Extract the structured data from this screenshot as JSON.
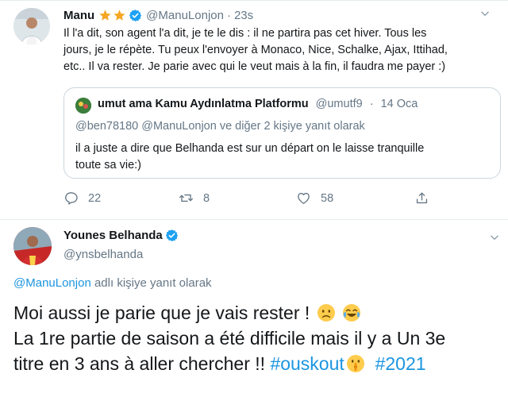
{
  "tweet1": {
    "name": "Manu",
    "handle": "@ManuLonjon",
    "separator": "·",
    "time": "23s",
    "text_lines": [
      "Il l'a dit, son agent l'a dit, je te le dis : il ne partira pas cet hiver. Tous les",
      "jours, je le répète. Tu peux l'envoyer à Monaco, Nice, Schalke, Ajax, Ittihad,",
      "etc.. Il va rester. Je parie avec qui le veut mais à la fin, il faudra me payer :)"
    ],
    "quoted": {
      "name": "umut ama Kamu Aydınlatma Platformu",
      "handle": "@umutf9",
      "separator": "·",
      "date": "14 Oca",
      "reply_line": "@ben78180 @ManuLonjon ve diğer 2 kişiye yanıt olarak",
      "text_lines": [
        "il a juste a dire que Belhanda est sur un départ on le laisse tranquille",
        "toute sa vie:)"
      ]
    },
    "actions": {
      "reply_count": "22",
      "retweet_count": "8",
      "like_count": "58"
    }
  },
  "tweet2": {
    "name": "Younes Belhanda",
    "handle": "@ynsbelhanda",
    "reply_mention": "@ManuLonjon",
    "reply_suffix": "adlı kişiye yanıt olarak",
    "line1": "Moi aussi je parie que je vais rester !",
    "line2": "La 1re partie de saison a été difficile mais il y a Un 3e",
    "line3_text": "titre en 3 ans à aller chercher !! ",
    "hashtag1": "#ouskout",
    "hashtag2": "#2021"
  },
  "colors": {
    "link": "#1b95e0",
    "secondary_text": "#657786",
    "verified": "#1da1f2",
    "star": "#f5a623",
    "border": "#ccd6dd"
  },
  "icons": [
    "star-icon",
    "verified-badge-icon",
    "chevron-down-icon",
    "reply-icon",
    "retweet-icon",
    "like-icon",
    "share-icon",
    "worried-face-emoji",
    "crying-laughing-emoji",
    "shushing-face-emoji"
  ]
}
